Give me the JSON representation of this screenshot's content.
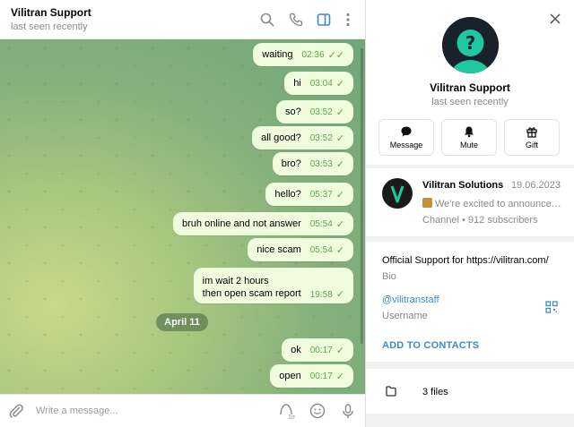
{
  "chat": {
    "title": "Vilitran Support",
    "status": "last seen recently",
    "composer_placeholder": "Write a message...",
    "sticker_badge": "1m",
    "date_separator": "April 11",
    "messages": [
      {
        "text": "waiting",
        "time": "02:36",
        "read": true
      },
      {
        "text": "hi",
        "time": "03:04",
        "read": true
      },
      {
        "text": "so?",
        "time": "03:52",
        "read": true
      },
      {
        "text": "all good?",
        "time": "03:52",
        "read": true
      },
      {
        "text": "bro?",
        "time": "03:53",
        "read": true
      },
      {
        "text": "hello?",
        "time": "05:37",
        "read": true
      },
      {
        "text": "bruh online and not answer",
        "time": "05:54",
        "read": true
      },
      {
        "text": "nice scam",
        "time": "05:54",
        "read": true
      },
      {
        "text_line1": "im wait 2 hours",
        "text_line2": "then open scam report",
        "time": "19:58",
        "read": true
      },
      {
        "text": "ok",
        "time": "00:17",
        "read": true
      },
      {
        "text": "open",
        "time": "00:17",
        "read": true
      }
    ]
  },
  "profile": {
    "name": "Vilitran Support",
    "status": "last seen recently",
    "actions": [
      {
        "label": "Message",
        "icon": "message-icon"
      },
      {
        "label": "Mute",
        "icon": "bell-icon"
      },
      {
        "label": "Gift",
        "icon": "gift-icon"
      }
    ],
    "channel": {
      "name": "Vilitran Solutions",
      "date": "19.06.2023",
      "last_message": "We're excited to announce ...",
      "meta": "Channel • 912 subscribers"
    },
    "bio": "Official Support for https://vilitran.com/",
    "bio_label": "Bio",
    "username": "@vilitranstaff",
    "username_label": "Username",
    "add_contacts": "ADD TO CONTACTS",
    "files": "3 files"
  },
  "colors": {
    "accent": "#3f8ac9",
    "bubble_out": "#effdde",
    "check_green": "#5da351",
    "avatar_teal": "#1ec9a2"
  }
}
